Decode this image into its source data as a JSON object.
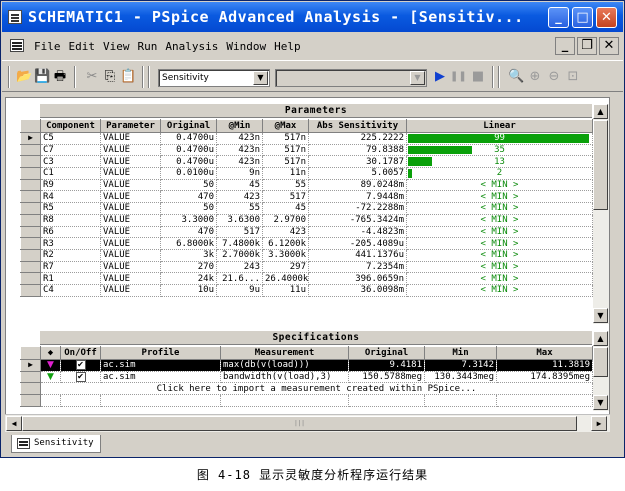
{
  "window": {
    "title": "SCHEMATIC1 - PSpice Advanced Analysis - [Sensitiv...",
    "caption_buttons": [
      "minimize-icon",
      "maximize-icon",
      "close-icon"
    ]
  },
  "menu": {
    "items": [
      "File",
      "Edit",
      "View",
      "Run",
      "Analysis",
      "Window",
      "Help"
    ],
    "mdi_buttons": [
      "_",
      "̧",
      "X"
    ]
  },
  "toolbar": {
    "analysis_select": "Sensitivity",
    "profile_select": "",
    "icons": [
      "open-icon",
      "save-icon",
      "print-icon",
      "cut-icon",
      "copy-icon",
      "paste-icon",
      "run-icon",
      "pause-icon",
      "stop-icon",
      "zoom-fit-icon",
      "zoom-in-icon",
      "zoom-out-icon",
      "zoom-area-icon"
    ]
  },
  "parameters": {
    "title": "Parameters",
    "columns": [
      "Component",
      "Parameter",
      "Original",
      "@Min",
      "@Max",
      "Abs Sensitivity",
      "Linear"
    ],
    "rows": [
      {
        "marker": "▶",
        "component": "C5",
        "parameter": "VALUE",
        "original": "0.4700u",
        "min": "423n",
        "max": "517n",
        "abs": "225.2222",
        "linear": "99",
        "fill": 0.99
      },
      {
        "marker": "",
        "component": "C7",
        "parameter": "VALUE",
        "original": "0.4700u",
        "min": "423n",
        "max": "517n",
        "abs": "79.8388",
        "linear": "35",
        "fill": 0.35
      },
      {
        "marker": "",
        "component": "C3",
        "parameter": "VALUE",
        "original": "0.4700u",
        "min": "423n",
        "max": "517n",
        "abs": "30.1787",
        "linear": "13",
        "fill": 0.13
      },
      {
        "marker": "",
        "component": "C1",
        "parameter": "VALUE",
        "original": "0.0100u",
        "min": "9n",
        "max": "11n",
        "abs": "5.0057",
        "linear": "2",
        "fill": 0.02
      },
      {
        "marker": "",
        "component": "R9",
        "parameter": "VALUE",
        "original": "50",
        "min": "45",
        "max": "55",
        "abs": "89.0248m",
        "linear": "< MIN >",
        "fill": 0
      },
      {
        "marker": "",
        "component": "R4",
        "parameter": "VALUE",
        "original": "470",
        "min": "423",
        "max": "517",
        "abs": "7.9448m",
        "linear": "< MIN >",
        "fill": 0
      },
      {
        "marker": "",
        "component": "R5",
        "parameter": "VALUE",
        "original": "50",
        "min": "55",
        "max": "45",
        "abs": "-72.2288m",
        "linear": "< MIN >",
        "fill": 0
      },
      {
        "marker": "",
        "component": "R8",
        "parameter": "VALUE",
        "original": "3.3000",
        "min": "3.6300",
        "max": "2.9700",
        "abs": "-765.3424m",
        "linear": "< MIN >",
        "fill": 0
      },
      {
        "marker": "",
        "component": "R6",
        "parameter": "VALUE",
        "original": "470",
        "min": "517",
        "max": "423",
        "abs": "-4.4823m",
        "linear": "< MIN >",
        "fill": 0
      },
      {
        "marker": "",
        "component": "R3",
        "parameter": "VALUE",
        "original": "6.8000k",
        "min": "7.4800k",
        "max": "6.1200k",
        "abs": "-205.4089u",
        "linear": "< MIN >",
        "fill": 0
      },
      {
        "marker": "",
        "component": "R2",
        "parameter": "VALUE",
        "original": "3k",
        "min": "2.7000k",
        "max": "3.3000k",
        "abs": "441.1376u",
        "linear": "< MIN >",
        "fill": 0
      },
      {
        "marker": "",
        "component": "R7",
        "parameter": "VALUE",
        "original": "270",
        "min": "243",
        "max": "297",
        "abs": "7.2354m",
        "linear": "< MIN >",
        "fill": 0
      },
      {
        "marker": "",
        "component": "R1",
        "parameter": "VALUE",
        "original": "24k",
        "min": "21.6...",
        "max": "26.4000k",
        "abs": "396.0659n",
        "linear": "< MIN >",
        "fill": 0
      },
      {
        "marker": "",
        "component": "C4",
        "parameter": "VALUE",
        "original": "10u",
        "min": "9u",
        "max": "11u",
        "abs": "36.0098m",
        "linear": "< MIN >",
        "fill": 0
      }
    ]
  },
  "specifications": {
    "title": "Specifications",
    "columns": [
      "◆",
      "On/Off",
      "Profile",
      "Measurement",
      "Original",
      "Min",
      "Max"
    ],
    "rows": [
      {
        "marker": "▶",
        "flag": "▼",
        "flag_color": "#e020d0",
        "on": "✔",
        "profile": "ac.sim",
        "measurement": "max(db(v(load)))",
        "original": "9.4181",
        "min": "7.3142",
        "max": "11.3819",
        "selected": true
      },
      {
        "marker": "",
        "flag": "▼",
        "flag_color": "#10a010",
        "on": "✔",
        "profile": "ac.sim",
        "measurement": "bandwidth(v(load),3)",
        "original": "150.5788meg",
        "min": "130.3443meg",
        "max": "174.8395meg",
        "selected": false
      }
    ],
    "import_hint": "Click here to import a measurement created within PSpice..."
  },
  "status_tab": {
    "label": "Sensitivity"
  },
  "caption": "图 4-18 显示灵敏度分析程序运行结果",
  "colors": {
    "titlebar": "#0a5ae0",
    "bar_fill": "#0aa00a",
    "linear_text": "#0a8a0a"
  }
}
